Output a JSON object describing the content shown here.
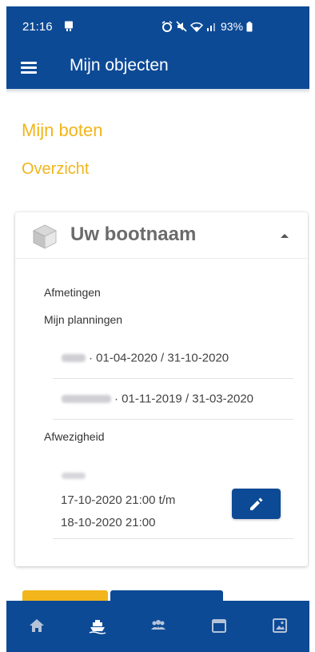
{
  "status_bar": {
    "time": "21:16",
    "battery": "93%"
  },
  "app_bar": {
    "title": "Mijn objecten",
    "menu_icon": "hamburger-menu-icon"
  },
  "page": {
    "heading": "Mijn boten",
    "subheading": "Overzicht"
  },
  "card": {
    "boat_name": "Uw bootnaam",
    "boat_icon": "cube-icon",
    "collapse_icon": "chevron-up-icon",
    "dimensions_label": "Afmetingen",
    "plannings_label": "Mijn planningen",
    "plannings": [
      {
        "range": "· 01-04-2020 / 31-10-2020"
      },
      {
        "range": "· 01-11-2019 / 31-03-2020"
      }
    ],
    "absence_label": "Afwezigheid",
    "absence": {
      "line1": "17-10-2020 21:00 t/m",
      "line2": "18-10-2020 21:00",
      "edit_icon": "pencil-icon"
    }
  },
  "bottom_nav": {
    "items": [
      {
        "icon": "home-icon"
      },
      {
        "icon": "boat-icon"
      },
      {
        "icon": "people-icon"
      },
      {
        "icon": "calendar-icon"
      },
      {
        "icon": "gallery-icon"
      }
    ]
  },
  "colors": {
    "primary": "#0d4a96",
    "accent": "#f2b51b"
  }
}
